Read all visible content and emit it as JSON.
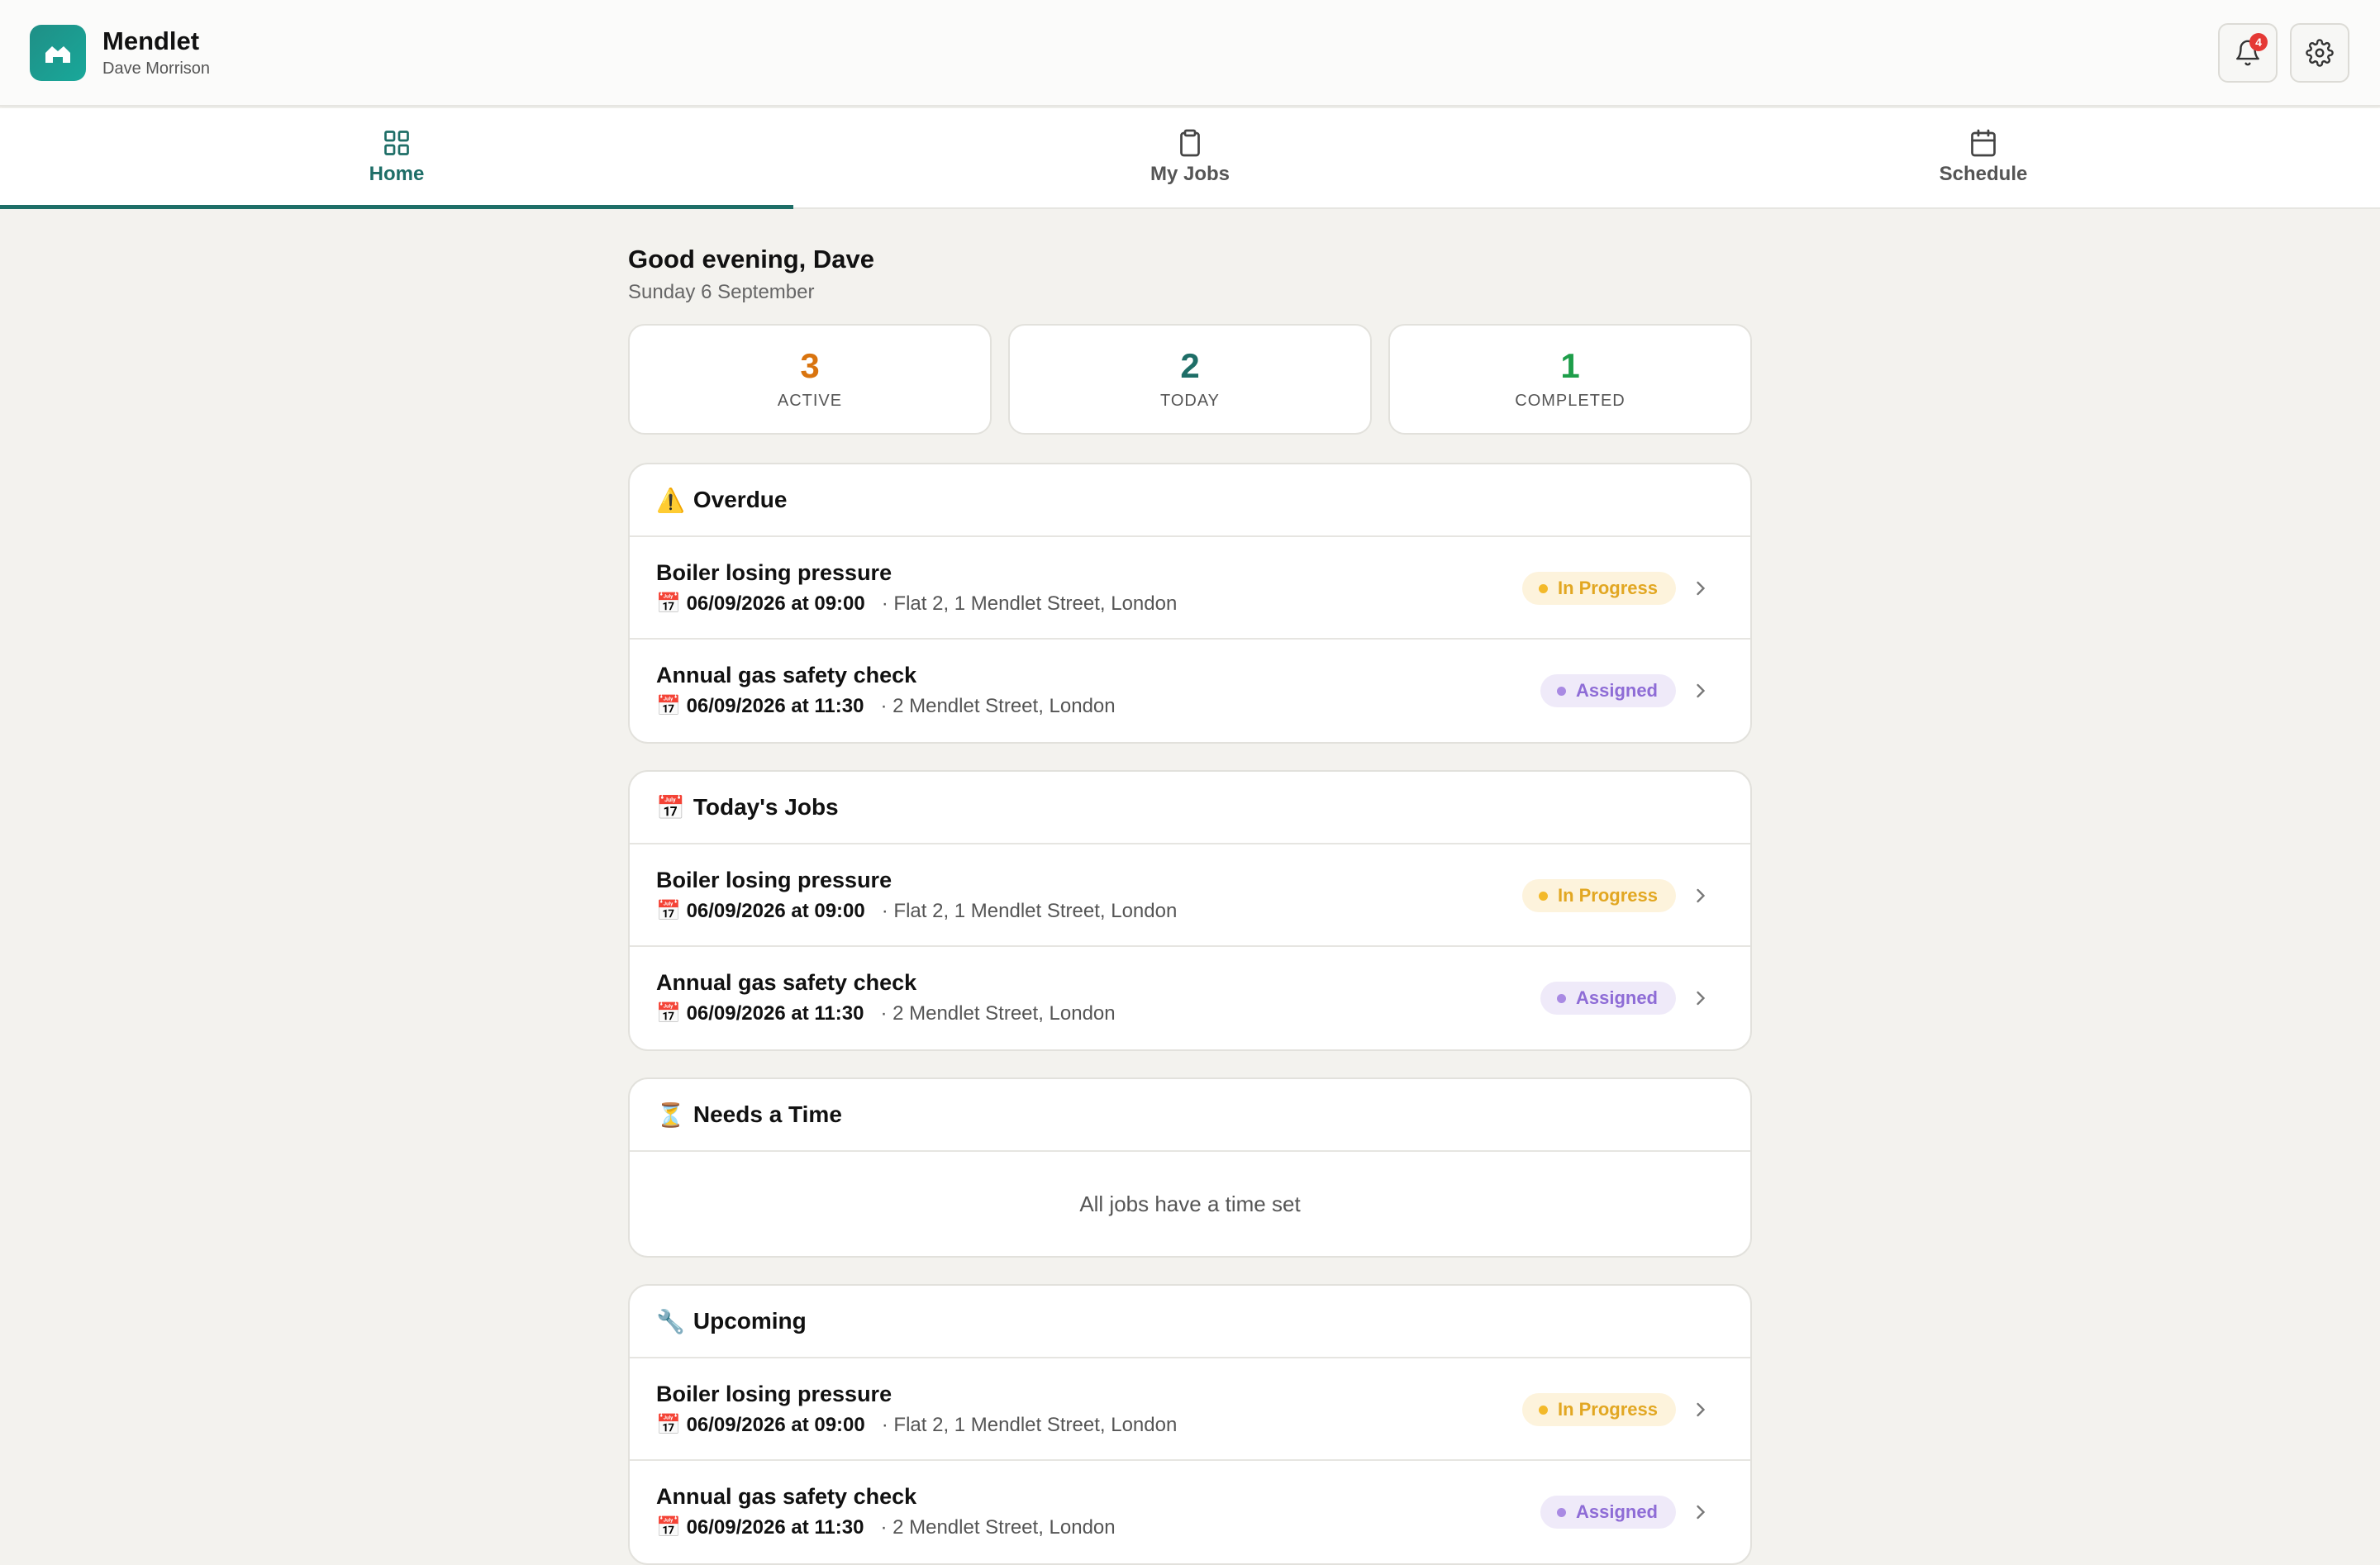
{
  "header": {
    "app_name": "Mendlet",
    "user_name": "Dave Morrison",
    "notification_count": "4",
    "logo_icon": "house-icon",
    "bell_icon": "bell-icon",
    "settings_icon": "gear-icon"
  },
  "tabs": [
    {
      "label": "Home",
      "icon": "grid-icon",
      "active": true
    },
    {
      "label": "My Jobs",
      "icon": "clipboard-icon",
      "active": false
    },
    {
      "label": "Schedule",
      "icon": "calendar-icon",
      "active": false
    }
  ],
  "greeting": "Good evening, Dave",
  "date": "Sunday 6 September",
  "stats": [
    {
      "value": "3",
      "label": "ACTIVE",
      "color": "#d9740f"
    },
    {
      "value": "2",
      "label": "TODAY",
      "color": "#1e6e67"
    },
    {
      "value": "1",
      "label": "COMPLETED",
      "color": "#1e9e4a"
    }
  ],
  "sections": {
    "overdue": {
      "emoji": "⚠️",
      "title": "Overdue",
      "jobs": [
        {
          "title": "Boiler losing pressure",
          "datetime": "06/09/2026 at 09:00",
          "address": "· Flat 2, 1 Mendlet Street, London",
          "status": "In Progress"
        },
        {
          "title": "Annual gas safety check",
          "datetime": "06/09/2026 at 11:30",
          "address": "· 2 Mendlet Street, London",
          "status": "Assigned"
        }
      ]
    },
    "today": {
      "emoji": "📅",
      "title": "Today's Jobs",
      "jobs": [
        {
          "title": "Boiler losing pressure",
          "datetime": "06/09/2026 at 09:00",
          "address": "· Flat 2, 1 Mendlet Street, London",
          "status": "In Progress"
        },
        {
          "title": "Annual gas safety check",
          "datetime": "06/09/2026 at 11:30",
          "address": "· 2 Mendlet Street, London",
          "status": "Assigned"
        }
      ]
    },
    "needs_time": {
      "emoji": "⏳",
      "title": "Needs a Time",
      "empty_text": "All jobs have a time set"
    },
    "upcoming": {
      "emoji": "🔧",
      "title": "Upcoming",
      "jobs": [
        {
          "title": "Boiler losing pressure",
          "datetime": "06/09/2026 at 09:00",
          "address": "· Flat 2, 1 Mendlet Street, London",
          "status": "In Progress"
        },
        {
          "title": "Annual gas safety check",
          "datetime": "06/09/2026 at 11:30",
          "address": "· 2 Mendlet Street, London",
          "status": "Assigned"
        }
      ]
    }
  },
  "colors": {
    "accent": "#1e6e67",
    "in_progress": "#e2a722",
    "assigned": "#8e6cd6"
  }
}
